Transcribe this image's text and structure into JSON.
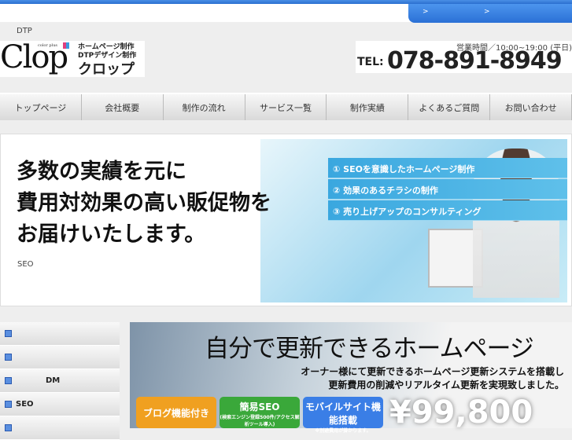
{
  "topbar": {
    "link1": ">",
    "link2": ">"
  },
  "header": {
    "tagline": "DTP",
    "logo": {
      "name": "Clop",
      "sub": "color plus",
      "line1": "ホームページ制作",
      "line2": "DTPデザイン制作",
      "line3": "クロップ"
    },
    "hours": "営業時間／10:00~19:00 (平日)",
    "tel_label": "TEL:",
    "tel": "078-891-8949"
  },
  "nav": [
    "トップページ",
    "会社概要",
    "制作の流れ",
    "サービス一覧",
    "制作実績",
    "よくあるご質問",
    "お問い合わせ"
  ],
  "hero": {
    "catch": [
      "多数の実績を元に",
      "費用対効果の高い販促物を",
      "お届けいたします。"
    ],
    "seo": "SEO",
    "points": [
      "① SEOを意識したホームページ制作",
      "② 効果のあるチラシの制作",
      "③ 売り上げアップのコンサルティング"
    ]
  },
  "sidebar": [
    "",
    "",
    "DM",
    "SEO",
    ""
  ],
  "banner": {
    "heading": "自分で更新できるホームページ",
    "sub1": "オーナー様にて更新できるホームページ更新システムを搭載し",
    "sub2": "更新費用の削減やリアルタイム更新を実現致しました。",
    "badge1": "ブログ機能付き",
    "badge2": "簡易SEO",
    "badge2_note": "(検索エンジン登録500件/アクセス解析ツール導入)",
    "badge3": "モバイルサイト機能搭載",
    "badge3_note": "※別途費用が掛かります。",
    "price": "¥99,800"
  }
}
